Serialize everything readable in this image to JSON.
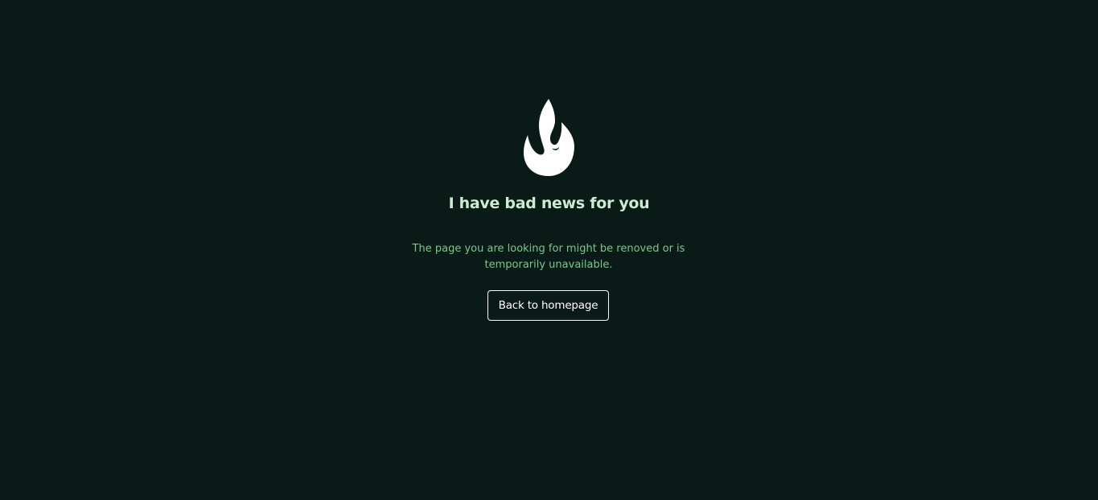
{
  "colors": {
    "background": "#0a1a16",
    "title": "#c9ecd2",
    "message": "#75c98e",
    "button_border": "#ffffff",
    "button_text": "#ffffff",
    "logo": "#ffffff"
  },
  "logo": {
    "icon": "flame-logo-icon"
  },
  "error": {
    "title": "I have bad news for you",
    "message": "The page you are looking for might be renoved or is temporarily unavailable."
  },
  "actions": {
    "back_label": "Back to homepage"
  }
}
